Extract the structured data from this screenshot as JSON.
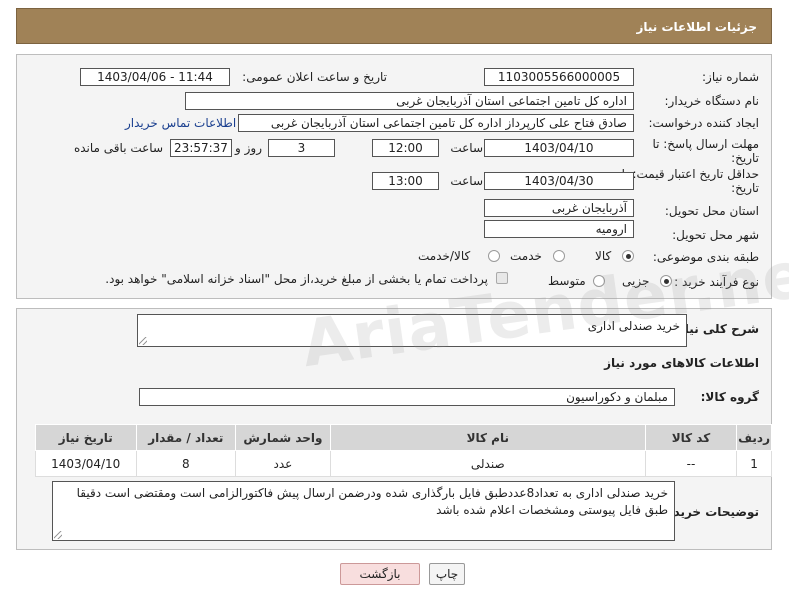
{
  "header": {
    "title": "جزئیات اطلاعات نیاز"
  },
  "form": {
    "need_number": {
      "label": "شماره نیاز:",
      "value": "1103005566000005"
    },
    "announce_datetime": {
      "label": "تاریخ و ساعت اعلان عمومی:",
      "value": "1403/04/06 - 11:44"
    },
    "buyer_org": {
      "label": "نام دستگاه خریدار:",
      "value": "اداره کل تامین اجتماعی استان آذربایجان غربی"
    },
    "requester": {
      "label": "ایجاد کننده درخواست:",
      "value": "صادق فتاح علی کارپرداز اداره کل تامین اجتماعی استان آذربایجان غربی",
      "contact_link": "اطلاعات تماس خریدار"
    },
    "reply_deadline": {
      "label_line1": "مهلت ارسال پاسخ: تا",
      "label_line2": "تاریخ:",
      "date": "1403/04/10",
      "time_label": "ساعت",
      "time": "12:00",
      "days": "3",
      "days_label": "روز و",
      "remaining": "23:57:37",
      "remaining_label": "ساعت باقی مانده"
    },
    "price_validity": {
      "label_line1": "حداقل تاریخ اعتبار قیمت: تا",
      "label_line2": "تاریخ:",
      "date": "1403/04/30",
      "time_label": "ساعت",
      "time": "13:00"
    },
    "delivery_province": {
      "label": "استان محل تحویل:",
      "value": "آذربایجان غربی"
    },
    "delivery_city": {
      "label": "شهر محل تحویل:",
      "value": "ارومیه"
    },
    "category": {
      "label": "طبقه بندی موضوعی:",
      "options": [
        "کالا",
        "خدمت",
        "کالا/خدمت"
      ],
      "selected": "کالا"
    },
    "purchase_process": {
      "label": "نوع فرآیند خرید :",
      "options": [
        "جزیی",
        "متوسط"
      ],
      "selected": "جزیی",
      "note": "پرداخت تمام یا بخشی از مبلغ خرید،از محل \"اسناد خزانه اسلامی\" خواهد بود."
    }
  },
  "details": {
    "general_desc_label": "شرح کلی نیاز:",
    "general_desc_value": "خرید صندلی اداری",
    "goods_info_title": "اطلاعات کالاهای مورد نیاز",
    "goods_group_label": "گروه کالا:",
    "goods_group_value": "مبلمان و دکوراسیون",
    "table": {
      "headers": [
        "ردیف",
        "کد کالا",
        "نام کالا",
        "واحد شمارش",
        "تعداد / مقدار",
        "تاریخ نیاز"
      ],
      "rows": [
        [
          "1",
          "--",
          "صندلی",
          "عدد",
          "8",
          "1403/04/10"
        ]
      ]
    },
    "buyer_notes_label": "توضیحات خریدار:",
    "buyer_notes_value": "خرید صندلی اداری به تعداد8عددطبق فایل بارگذاری شده ودرضمن ارسال پیش فاکتورالزامی است ومقتضی است دقیقا طبق فایل پیوستی ومشخصات اعلام شده  باشد"
  },
  "buttons": {
    "print": "چاپ",
    "back": "بازگشت"
  },
  "watermark": "AriaTender.neT",
  "colors": {
    "header_bg": "#a08257",
    "link": "#1a3f8f",
    "back_button_bg": "#f8dede"
  }
}
